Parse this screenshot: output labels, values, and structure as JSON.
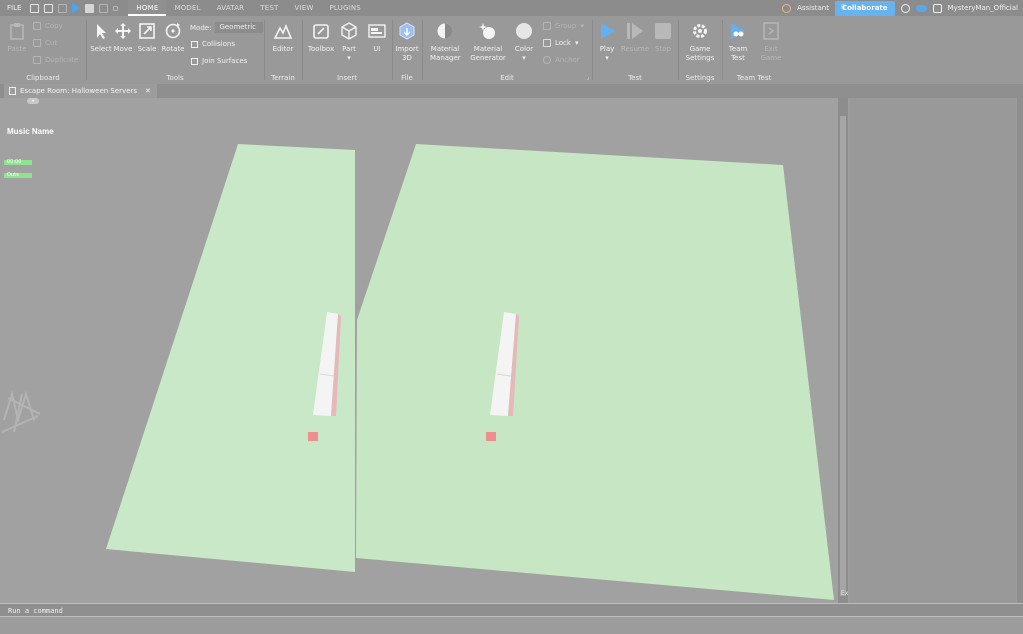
{
  "menubar": {
    "file": "FILE",
    "tabs": [
      "HOME",
      "MODEL",
      "AVATAR",
      "TEST",
      "VIEW",
      "PLUGINS"
    ],
    "assistant": "Assistant",
    "collaborate": "Collaborate",
    "username": "MysteryMan_Official"
  },
  "ribbon": {
    "clipboard": {
      "label": "Clipboard",
      "paste": "Paste",
      "copy": "Copy",
      "cut": "Cut",
      "duplicate": "Duplicate"
    },
    "tools": {
      "label": "Tools",
      "select": "Select",
      "move": "Move",
      "scale": "Scale",
      "rotate": "Rotate",
      "mode_label": "Mode:",
      "mode_value": "Geometric",
      "collisions": "Collisions",
      "join_surfaces": "Join Surfaces"
    },
    "terrain": {
      "label": "Terrain",
      "editor": "Editor"
    },
    "insert": {
      "label": "Insert",
      "toolbox": "Toolbox",
      "part": "Part",
      "ui": "UI"
    },
    "file": {
      "label": "File",
      "import3d_1": "Import",
      "import3d_2": "3D"
    },
    "edit": {
      "label": "Edit",
      "material_manager_1": "Material",
      "material_manager_2": "Manager",
      "material_generator_1": "Material",
      "material_generator_2": "Generator",
      "color": "Color",
      "group": "Group",
      "lock": "Lock",
      "anchor": "Anchor"
    },
    "test": {
      "label": "Test",
      "play": "Play",
      "resume": "Resume",
      "stop": "Stop"
    },
    "settings": {
      "label": "Settings",
      "game_settings_1": "Game",
      "game_settings_2": "Settings"
    },
    "team_test": {
      "label": "Team Test",
      "team_test_1": "Team",
      "team_test_2": "Test",
      "exit_game_1": "Exit",
      "exit_game_2": "Game"
    }
  },
  "doc_tab": {
    "title": "Escape Room: Halloween Servers"
  },
  "viewport": {
    "music_name": "Music Name",
    "label_a": "00:00",
    "label_b": "Outs"
  },
  "side_edge": {
    "top": "Fi",
    "bottom": "Ex"
  },
  "command": {
    "placeholder": "Run a command"
  },
  "colors": {
    "accent": "#67b3ef",
    "baseplate": "#c6e6c6",
    "part": "#f0f0f0",
    "spawn": "#ee8e8e"
  }
}
